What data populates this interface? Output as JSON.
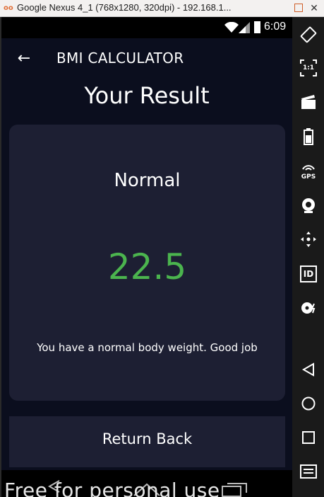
{
  "window": {
    "title": "Google Nexus 4_1 (768x1280, 320dpi) - 192.168.1...",
    "app_icon": "oo",
    "restore_icon": "window-restore-icon",
    "close_label": "✕"
  },
  "status_bar": {
    "time": "6:09",
    "icons": [
      "wifi-icon",
      "signal-icon",
      "battery-icon"
    ]
  },
  "app_bar": {
    "back_icon": "arrow-left-icon",
    "back_glyph": "←",
    "title": "BMI CALCULATOR"
  },
  "result": {
    "heading": "Your Result",
    "status": "Normal",
    "bmi_value": "22.5",
    "message": "You have a normal body weight. Good job"
  },
  "return_button": {
    "label": "Return Back"
  },
  "watermark": {
    "text": "Free for personal use"
  },
  "nav_bar": {
    "icons": [
      "back-triangle-icon",
      "home-circle-icon",
      "recents-square-icon"
    ]
  },
  "toolbar": {
    "items": [
      {
        "name": "rotate-icon"
      },
      {
        "name": "fullscreen-ratio-icon",
        "label": "1:1"
      },
      {
        "name": "clapperboard-icon"
      },
      {
        "name": "battery-icon"
      },
      {
        "name": "gps-icon",
        "label": "GPS"
      },
      {
        "name": "camera-icon"
      },
      {
        "name": "move-arrows-icon"
      },
      {
        "name": "id-icon",
        "label": "ID"
      },
      {
        "name": "disc-flash-icon"
      },
      {
        "name": "nav-back-icon"
      },
      {
        "name": "nav-home-icon"
      },
      {
        "name": "nav-recents-icon"
      },
      {
        "name": "menu-icon"
      }
    ]
  },
  "colors": {
    "background": "#0b0e1e",
    "card": "#1d1f33",
    "bmi_green": "#4bb44e",
    "text": "#ffffff"
  }
}
